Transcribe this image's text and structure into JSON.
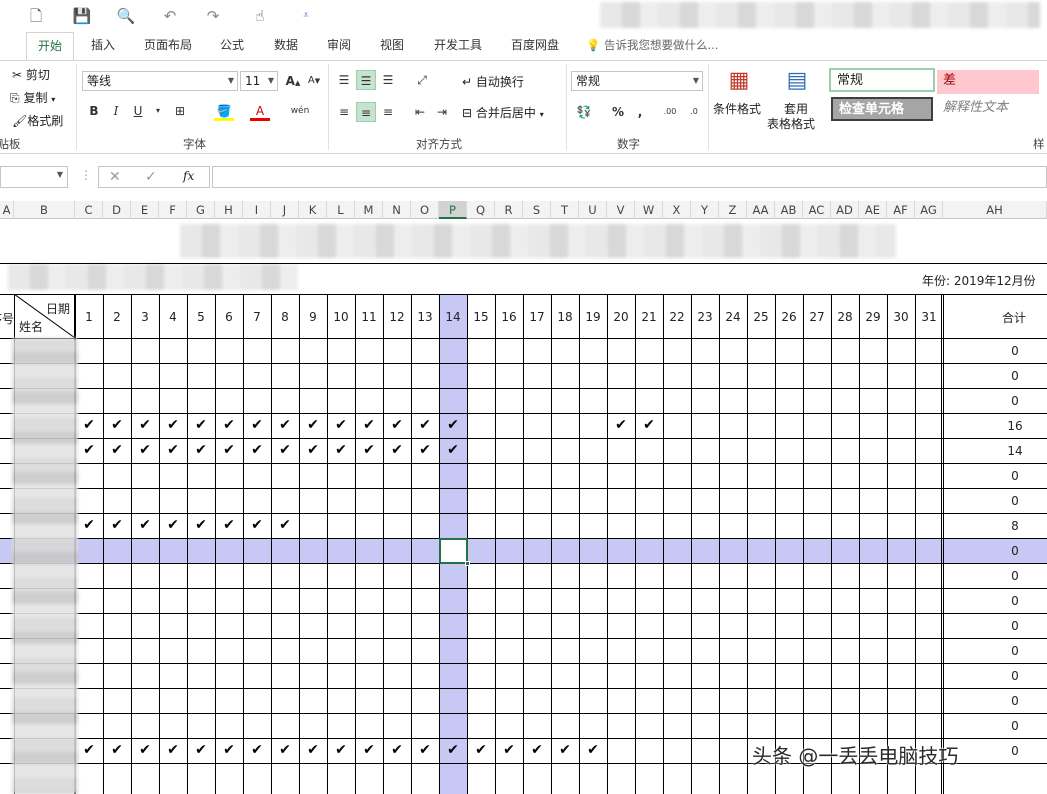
{
  "colors": {
    "accent": "#217346",
    "selection": "#c8c8f5",
    "bad_fill": "#ffc7ce",
    "good_border": "#9ccfae"
  },
  "qat": {
    "icons": [
      "new-file-icon",
      "save-icon",
      "print-preview-icon",
      "undo-icon",
      "redo-icon",
      "touch-mode-icon",
      "customize-icon"
    ]
  },
  "ribbon_tabs": [
    "开始",
    "插入",
    "页面布局",
    "公式",
    "数据",
    "审阅",
    "视图",
    "开发工具",
    "百度网盘"
  ],
  "tell_me": "告诉我您想要做什么...",
  "clipboard": {
    "cut": "剪切",
    "copy": "复制",
    "painter": "格式刷",
    "group": "剪贴板"
  },
  "font": {
    "name": "等线",
    "size": "11",
    "group": "字体",
    "bold": "B",
    "italic": "I",
    "underline": "U"
  },
  "alignment": {
    "wrap": "自动换行",
    "merge": "合并后居中",
    "group": "对齐方式"
  },
  "number": {
    "format": "常规",
    "group": "数字"
  },
  "styles": {
    "cond_format": "条件格式",
    "table_format_line1": "套用",
    "table_format_line2": "表格格式",
    "normal": "常规",
    "bad": "差",
    "check_cell": "检查单元格",
    "explanatory": "解释性文本",
    "group": "样"
  },
  "formula_bar": {
    "fx": "fx"
  },
  "columns": [
    "A",
    "B",
    "C",
    "D",
    "E",
    "F",
    "G",
    "H",
    "I",
    "J",
    "K",
    "L",
    "M",
    "N",
    "O",
    "P",
    "Q",
    "R",
    "S",
    "T",
    "U",
    "V",
    "W",
    "X",
    "Y",
    "Z",
    "AA",
    "AB",
    "AC",
    "AD",
    "AE",
    "AF",
    "AG",
    "AH"
  ],
  "selected_column": "P",
  "sheet": {
    "year_label": "年份: 2019年12月份",
    "header_no": "序号",
    "header_date": "日期",
    "header_name": "姓名",
    "header_total": "合计",
    "days": [
      "1",
      "2",
      "3",
      "4",
      "5",
      "6",
      "7",
      "8",
      "9",
      "10",
      "11",
      "12",
      "13",
      "14",
      "15",
      "16",
      "17",
      "18",
      "19",
      "20",
      "21",
      "22",
      "23",
      "24",
      "25",
      "26",
      "27",
      "28",
      "29",
      "30",
      "31"
    ],
    "check_symbol": "✔",
    "rows": [
      {
        "checks": [],
        "total": "0"
      },
      {
        "checks": [],
        "total": "0"
      },
      {
        "checks": [],
        "total": "0"
      },
      {
        "checks": [
          1,
          2,
          3,
          4,
          5,
          6,
          7,
          8,
          9,
          10,
          11,
          12,
          13,
          14,
          20,
          21
        ],
        "total": "16"
      },
      {
        "checks": [
          1,
          2,
          3,
          4,
          5,
          6,
          7,
          8,
          9,
          10,
          11,
          12,
          13,
          14
        ],
        "total": "14"
      },
      {
        "checks": [],
        "total": "0"
      },
      {
        "checks": [],
        "total": "0"
      },
      {
        "checks": [
          1,
          2,
          3,
          4,
          5,
          6,
          7,
          8
        ],
        "total": "8"
      },
      {
        "checks": [],
        "total": "0"
      },
      {
        "checks": [],
        "total": "0"
      },
      {
        "checks": [],
        "total": "0"
      },
      {
        "checks": [],
        "total": "0"
      },
      {
        "checks": [],
        "total": "0"
      },
      {
        "checks": [],
        "total": "0"
      },
      {
        "checks": [],
        "total": "0"
      },
      {
        "checks": [],
        "total": "0"
      },
      {
        "checks": [
          1,
          2,
          3,
          4,
          5,
          6,
          7,
          8,
          9,
          10,
          11,
          12,
          13,
          14,
          15,
          16,
          17,
          18,
          19
        ],
        "total": "0"
      }
    ],
    "selected_row_index": 8
  },
  "watermark": "头条 @一丢丢电脑技巧"
}
